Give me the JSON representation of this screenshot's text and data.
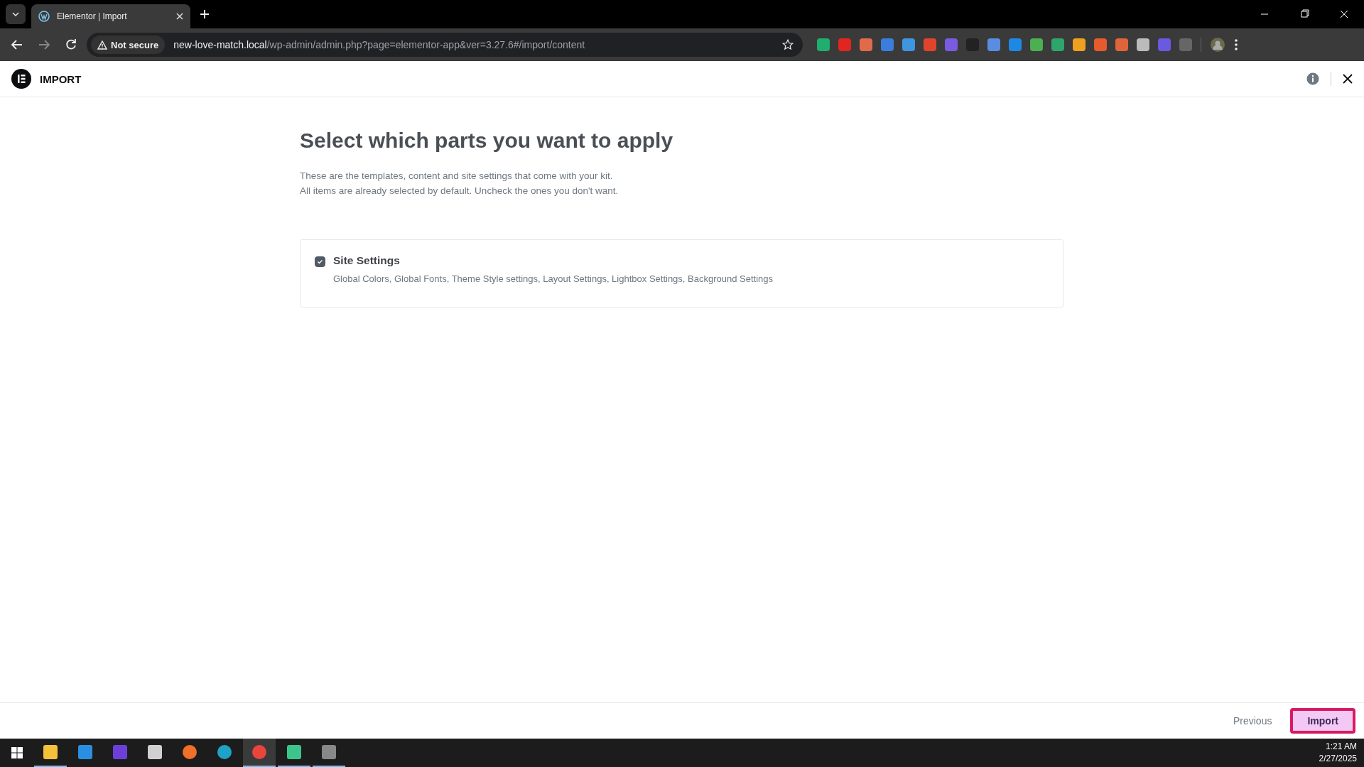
{
  "browser": {
    "tab": {
      "title": "Elementor | Import"
    },
    "address": {
      "security": "Not secure",
      "host": "new-love-match.local",
      "path": "/wp-admin/admin.php?page=elementor-app&ver=3.27.6#/import/content"
    }
  },
  "app_header": {
    "title": "IMPORT"
  },
  "heading": "Select which parts you want to apply",
  "description": [
    "These are the templates, content and site settings that come with your kit.",
    "All items are already selected by default. Uncheck the ones you don't want."
  ],
  "parts": [
    {
      "title": "Site Settings",
      "checked": true,
      "details": "Global Colors, Global Fonts, Theme Style settings, Layout Settings, Lightbox Settings, Background Settings"
    }
  ],
  "footer": {
    "buttons": [
      {
        "label": "Previous",
        "kind": "text"
      },
      {
        "label": "Import",
        "kind": "primary"
      }
    ]
  },
  "taskbar": {
    "apps": [
      {
        "kind": "files",
        "open": true,
        "selected": false
      },
      {
        "kind": "code",
        "open": false,
        "selected": false
      },
      {
        "kind": "video",
        "open": false,
        "selected": false
      },
      {
        "kind": "snip",
        "open": false,
        "selected": false
      },
      {
        "kind": "firefox",
        "open": false,
        "selected": false
      },
      {
        "kind": "edge",
        "open": false,
        "selected": false
      },
      {
        "kind": "chrome",
        "open": true,
        "selected": true
      },
      {
        "kind": "diamond",
        "open": true,
        "selected": false
      },
      {
        "kind": "capture",
        "open": true,
        "selected": false
      }
    ],
    "time": "1:21 AM",
    "date": "2/27/2025"
  }
}
